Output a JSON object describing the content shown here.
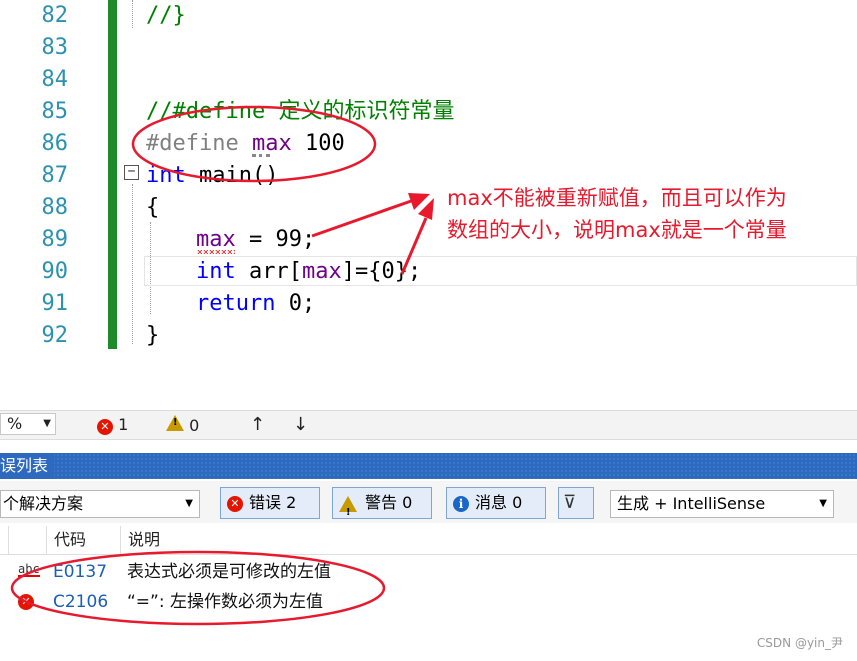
{
  "editor": {
    "line_numbers": [
      "82",
      "83",
      "84",
      "85",
      "86",
      "87",
      "88",
      "89",
      "90",
      "91",
      "92"
    ],
    "lines": {
      "l82": "//}",
      "l85": "//#define 定义的标识符常量",
      "l86_kw": "#define",
      "l86_name": "max",
      "l86_val": " 100",
      "l87_kw": "int",
      "l87_rest": " main()",
      "l88": "{",
      "l89_name": "max",
      "l89_rest": " = 99;",
      "l90_kw": "int",
      "l90_a": " arr[",
      "l90_name": "max",
      "l90_b": "]={0};",
      "l91_kw": "return",
      "l91_rest": " 0;",
      "l92": "}"
    },
    "collapse_glyph": "−"
  },
  "annotation": {
    "line1": "max不能被重新赋值，而且可以作为",
    "line2": "数组的大小，说明max就是一个常量",
    "color": "#e8192c"
  },
  "status_strip": {
    "zoom": "%",
    "errors": "1",
    "warnings": "0",
    "up_arrow": "↑",
    "down_arrow": "↓"
  },
  "error_list": {
    "title": "误列表",
    "scope": "个解决方案",
    "errors_btn": "错误 2",
    "warnings_btn": "警告 0",
    "messages_btn": "消息 0",
    "build_filter": "生成 + IntelliSense",
    "columns": [
      "代码",
      "说明"
    ],
    "rows": [
      {
        "code": "E0137",
        "desc": "表达式必须是可修改的左值",
        "icon": "abc-squiggle-icon"
      },
      {
        "code": "C2106",
        "desc": "“=”: 左操作数必须为左值",
        "icon": "error-icon"
      }
    ]
  },
  "watermark": "CSDN @yin_尹"
}
